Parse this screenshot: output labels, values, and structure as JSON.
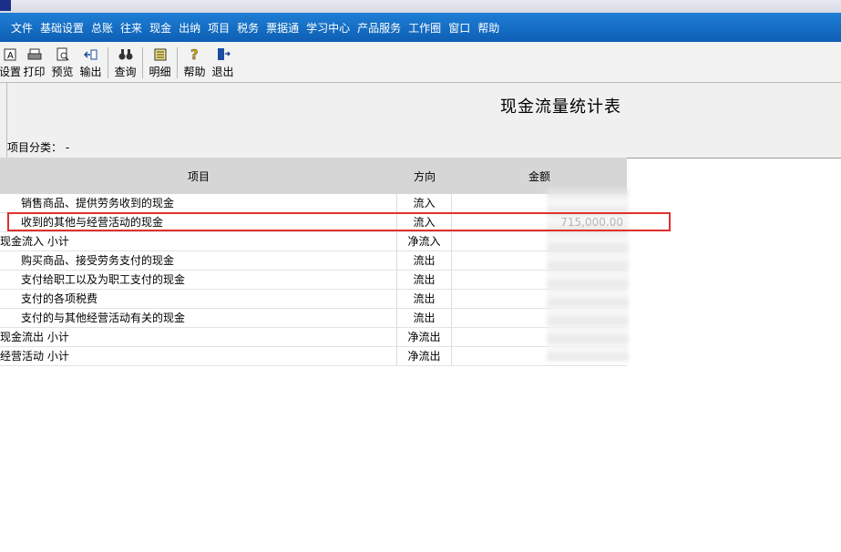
{
  "menu": [
    "文件",
    "基础设置",
    "总账",
    "往来",
    "现金",
    "出纳",
    "项目",
    "税务",
    "票据通",
    "学习中心",
    "产品服务",
    "工作圈",
    "窗口",
    "帮助"
  ],
  "toolbar": [
    {
      "label": "设置",
      "icon": "settings-icon"
    },
    {
      "label": "打印",
      "icon": "print-icon"
    },
    {
      "label": "预览",
      "icon": "preview-icon"
    },
    {
      "label": "输出",
      "icon": "export-icon"
    },
    {
      "label": "查询",
      "icon": "binoculars-icon"
    },
    {
      "label": "明细",
      "icon": "detail-icon"
    },
    {
      "label": "帮助",
      "icon": "help-icon"
    },
    {
      "label": "退出",
      "icon": "exit-icon"
    }
  ],
  "report": {
    "title": "现金流量统计表",
    "category": "项目分类：  -"
  },
  "table": {
    "headers": [
      "项目",
      "方向",
      "金额"
    ],
    "rows": [
      {
        "item": "销售商品、提供劳务收到的现金",
        "dir": "流入",
        "amount": ""
      },
      {
        "item": "收到的其他与经营活动的现金",
        "dir": "流入",
        "amount": "715,000.00"
      },
      {
        "item": "现金流入 小计",
        "dir": "净流入",
        "amount": ""
      },
      {
        "item": "购买商品、接受劳务支付的现金",
        "dir": "流出",
        "amount": ""
      },
      {
        "item": "支付给职工以及为职工支付的现金",
        "dir": "流出",
        "amount": ""
      },
      {
        "item": "支付的各项税费",
        "dir": "流出",
        "amount": ""
      },
      {
        "item": "支付的与其他经营活动有关的现金",
        "dir": "流出",
        "amount": ""
      },
      {
        "item": "现金流出 小计",
        "dir": "净流出",
        "amount": ""
      },
      {
        "item": "经营活动 小计",
        "dir": "净流出",
        "amount": ""
      }
    ]
  }
}
